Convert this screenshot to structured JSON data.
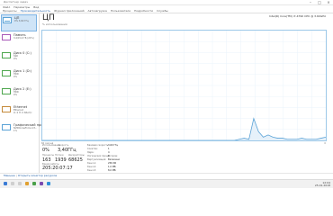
{
  "window": {
    "title": "Диспетчер задач"
  },
  "menu": [
    "Файл",
    "Параметры",
    "Вид"
  ],
  "tabs": [
    {
      "label": "Процессы",
      "active": false
    },
    {
      "label": "Производительность",
      "active": true
    },
    {
      "label": "Журнал приложений",
      "active": false
    },
    {
      "label": "Автозагрузка",
      "active": false
    },
    {
      "label": "Пользователи",
      "active": false
    },
    {
      "label": "Подробности",
      "active": false
    },
    {
      "label": "Службы",
      "active": false
    }
  ],
  "sidebar": [
    {
      "name": "ЦП",
      "value": "0% 3,60 ГГц"
    },
    {
      "name": "Память",
      "value": "3,4/15,9 ГБ (21%)"
    },
    {
      "name": "Диск 0 (C:)",
      "value": "SSD",
      "value2": "0%"
    },
    {
      "name": "Диск 1 (D:)",
      "value": "HDD",
      "value2": "0%"
    },
    {
      "name": "Диск 2 (E:)",
      "value": "HDD",
      "value2": "0%"
    },
    {
      "name": "Ethernet",
      "value": "Ethernet",
      "value2": "О: 0 П: 0 Кбит/с"
    },
    {
      "name": "Графический проц...",
      "value": "NVIDIA GeForce GT...",
      "value2": "1%"
    }
  ],
  "main": {
    "title": "ЦП",
    "subtitle": "% использования",
    "cpu_model": "Intel(R) Core(TM) i7-4790 CPU @ 3.60GHz",
    "graph_left": "60 секунд",
    "graph_right": "0"
  },
  "stats": {
    "usage_label": "Использование",
    "usage_value": "0%",
    "speed_label": "Скорость",
    "speed_value": "3,40ГГц",
    "processes_label": "Процессы",
    "processes_value": "163",
    "threads_label": "Потоки",
    "threads_value": "1939",
    "handles_label": "Дескрипторы",
    "handles_value": "68625",
    "uptime_label": "Время работы",
    "uptime_value": "205:20:07:17"
  },
  "specs": [
    {
      "label": "Базовая скорость:",
      "value": "3,60 ГГц"
    },
    {
      "label": "Сокетов:",
      "value": "1"
    },
    {
      "label": "Ядра:",
      "value": "4"
    },
    {
      "label": "Логических процессоров:",
      "value": "8"
    },
    {
      "label": "Виртуализация:",
      "value": "Включено"
    },
    {
      "label": "Кэш L1:",
      "value": "256 КБ"
    },
    {
      "label": "Кэш L2:",
      "value": "1,0 МБ"
    },
    {
      "label": "Кэш L3:",
      "value": "8,0 МБ"
    }
  ],
  "footer": {
    "less_details": "Меньше",
    "open_monitor": "Открыть монитор ресурсов"
  },
  "taskbar": {
    "time": "12:04",
    "date": "25.01.2018"
  },
  "colors": {
    "accent": "#1f5fa8",
    "graph_line": "#5aa2d6",
    "graph_border": "#9cc8e8"
  },
  "cpu_series": [
    0,
    0,
    0,
    0,
    0,
    0,
    0,
    0,
    0,
    0,
    0,
    0,
    0,
    0,
    0,
    0,
    0,
    0,
    0,
    0,
    0,
    0,
    0,
    0,
    0,
    0,
    0,
    0,
    0,
    0,
    0,
    0,
    0,
    0,
    0,
    0,
    0,
    0,
    0,
    0,
    0,
    1,
    2,
    1,
    20,
    8,
    3,
    5,
    3,
    2,
    2,
    1,
    1,
    1,
    2,
    1,
    1,
    1,
    2,
    3
  ]
}
